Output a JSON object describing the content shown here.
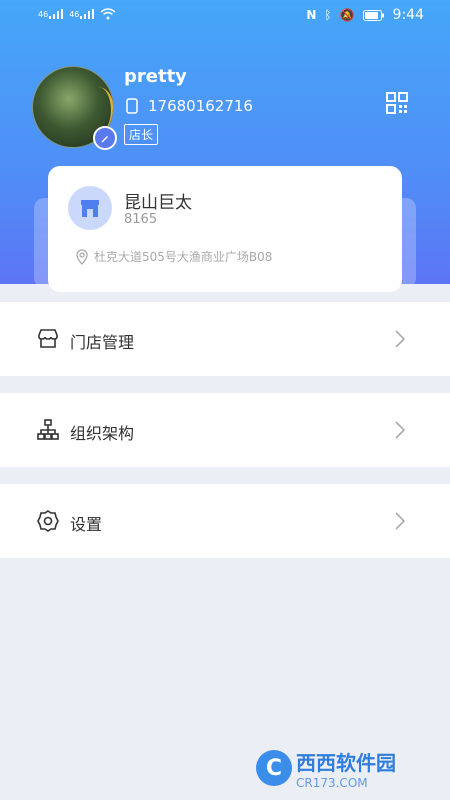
{
  "status_bar": {
    "signal_left": "46",
    "signal_right": "46",
    "time": "9:44"
  },
  "profile": {
    "username": "pretty",
    "phone": "17680162716",
    "role": "店长"
  },
  "store": {
    "name": "昆山巨太",
    "code": "8165",
    "address": "杜克大道505号大渔商业广场B08"
  },
  "menu": [
    {
      "label": "门店管理",
      "icon": "store-icon"
    },
    {
      "label": "组织架构",
      "icon": "org-chart-icon"
    },
    {
      "label": "设置",
      "icon": "gear-icon"
    }
  ],
  "watermark": {
    "brand": "西西",
    "text": "软件园",
    "sub": "CR173.COM"
  },
  "colors": {
    "header_top": "#45a7f8",
    "header_bottom": "#5e72f5",
    "background": "#eceef6"
  }
}
